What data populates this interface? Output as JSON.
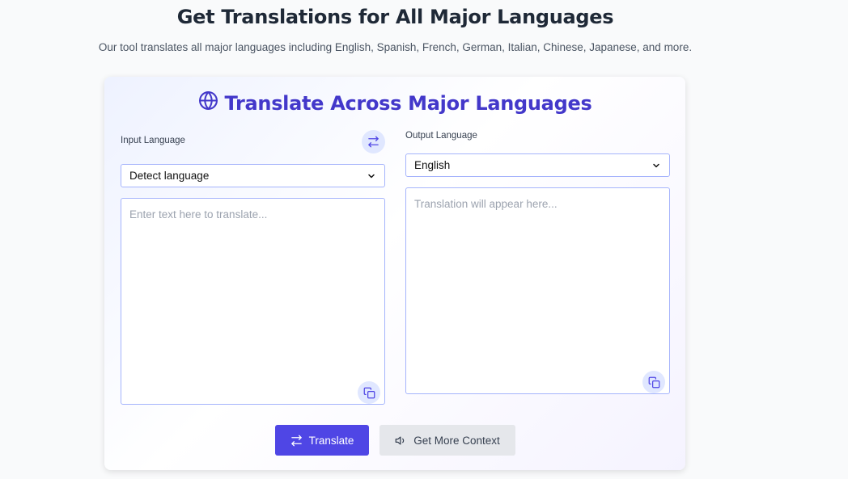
{
  "header": {
    "title": "Get Translations for All Major Languages",
    "subtitle": "Our tool translates all major languages including English, Spanish, French, German, Italian, Chinese, Japanese, and more."
  },
  "card": {
    "title": "Translate Across Major Languages",
    "input": {
      "label": "Input Language",
      "selected": "Detect language",
      "placeholder": "Enter text here to translate..."
    },
    "output": {
      "label": "Output Language",
      "selected": "English",
      "placeholder": "Translation will appear here..."
    },
    "translate_label": "Translate",
    "context_label": "Get More Context"
  },
  "colors": {
    "accent": "#4338ca",
    "primary_button": "#4f46e5",
    "secondary_button": "#e5e7eb",
    "field_border": "#a5b4fc",
    "icon_bg": "#e0e7ff"
  },
  "icons": [
    "globe-icon",
    "swap-icon",
    "chevron-down-icon",
    "copy-icon",
    "speaker-icon"
  ]
}
